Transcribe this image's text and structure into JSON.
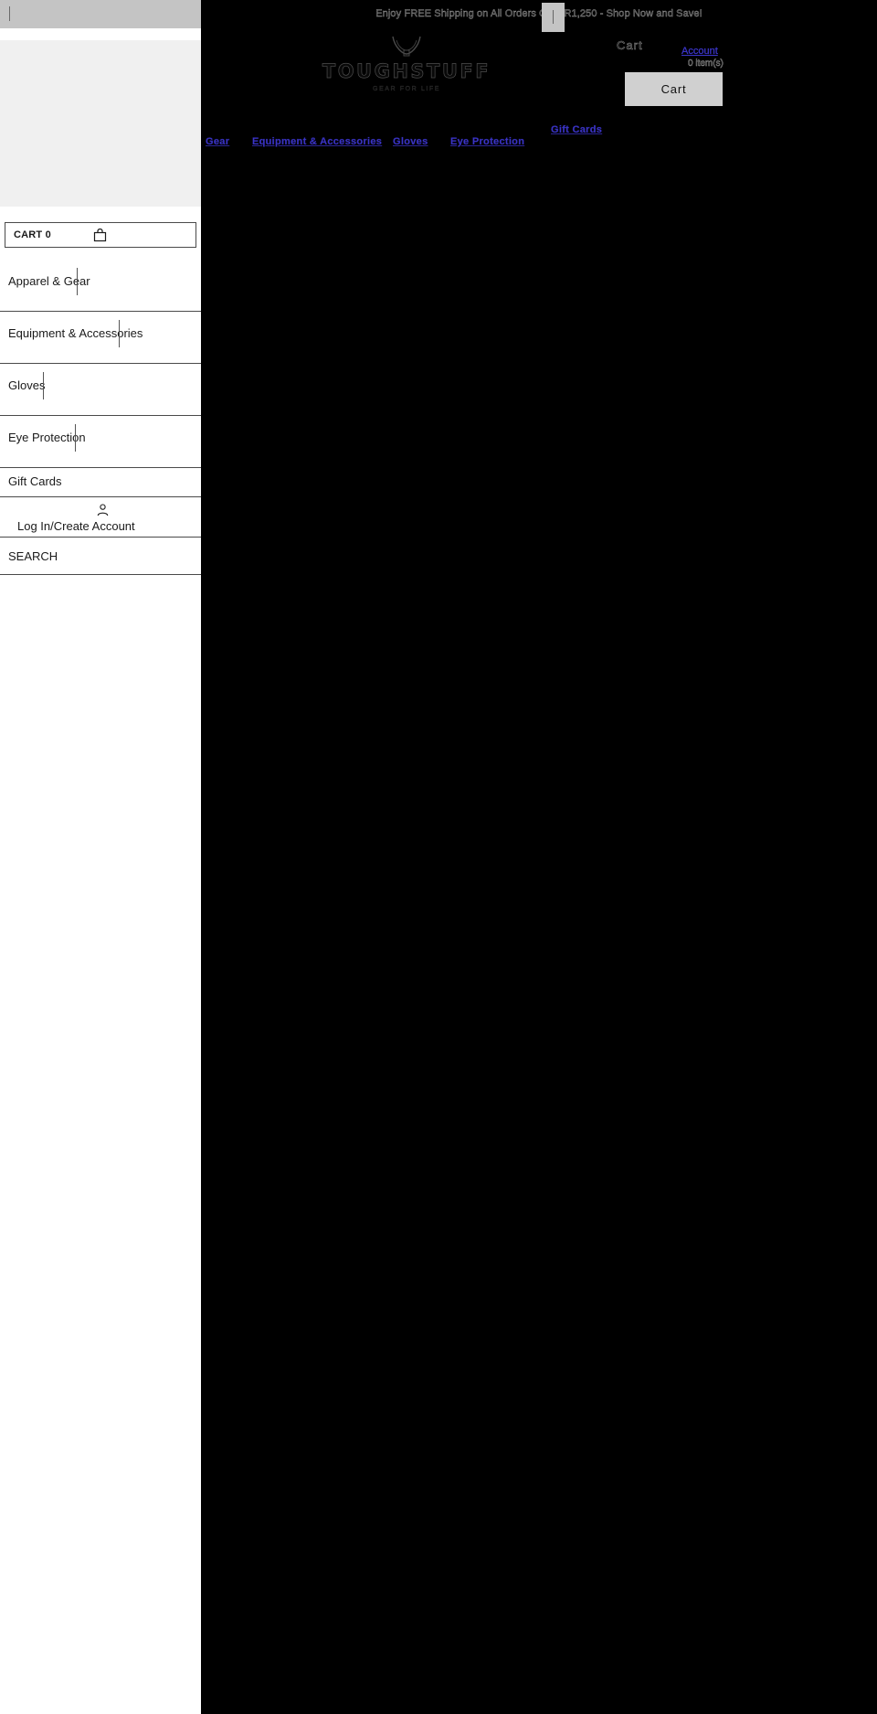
{
  "announcement": {
    "text": "Enjoy FREE Shipping on All Orders Over R1,250 - Shop Now and Save!",
    "close_icon": "close-icon"
  },
  "brand": {
    "name": "TOUGHSTUFF",
    "tagline": "GEAR FOR LIFE",
    "logo_icon": "horn-logo-icon"
  },
  "header": {
    "cart_word": "Cart",
    "account_label": "Account",
    "item_count": "0 item(s)",
    "cart_button": "Cart"
  },
  "nav": {
    "items": [
      {
        "label": "Gear"
      },
      {
        "label": "Equipment & Accessories"
      },
      {
        "label": "Gloves"
      },
      {
        "label": "Eye Protection"
      },
      {
        "label": "Gift Cards"
      }
    ]
  },
  "sidebar": {
    "cart": {
      "label": "CART 0",
      "icon": "shopping-bag-icon"
    },
    "items": [
      {
        "label": "Apparel & Gear",
        "has_submenu": true
      },
      {
        "label": "Equipment & Accessories",
        "has_submenu": true
      },
      {
        "label": "Gloves",
        "has_submenu": true
      },
      {
        "label": "Eye Protection",
        "has_submenu": true
      },
      {
        "label": "Gift Cards",
        "has_submenu": false
      }
    ],
    "account": {
      "label": "Log In/Create Account",
      "icon": "person-icon"
    },
    "search": {
      "label": "SEARCH"
    }
  },
  "colors": {
    "link": "#3b35c8",
    "announcement_bg": "#000000",
    "panel_bg": "#f0f0f0",
    "button_bg": "#d0d0d0",
    "topbar_bg": "#c4c4c4"
  }
}
